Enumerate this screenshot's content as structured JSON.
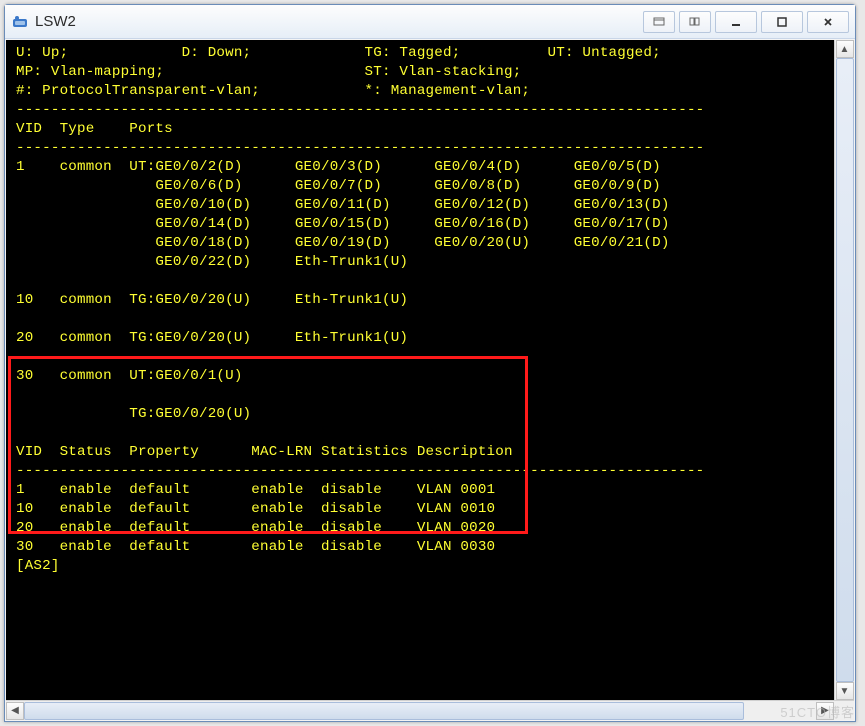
{
  "window": {
    "title": "LSW2"
  },
  "legend": {
    "line1": "U: Up;             D: Down;             TG: Tagged;          UT: Untagged;",
    "line2": "MP: Vlan-mapping;                       ST: Vlan-stacking;",
    "line3": "#: ProtocolTransparent-vlan;            *: Management-vlan;"
  },
  "dash": "-------------------------------------------------------------------------------",
  "hdr1": "VID  Type    Ports",
  "ports": {
    "l1": "1    common  UT:GE0/0/2(D)      GE0/0/3(D)      GE0/0/4(D)      GE0/0/5(D)",
    "l2": "                GE0/0/6(D)      GE0/0/7(D)      GE0/0/8(D)      GE0/0/9(D)",
    "l3": "                GE0/0/10(D)     GE0/0/11(D)     GE0/0/12(D)     GE0/0/13(D)",
    "l4": "                GE0/0/14(D)     GE0/0/15(D)     GE0/0/16(D)     GE0/0/17(D)",
    "l5": "                GE0/0/18(D)     GE0/0/19(D)     GE0/0/20(U)     GE0/0/21(D)",
    "l6": "                GE0/0/22(D)     Eth-Trunk1(U)",
    "l7": "",
    "l8": "10   common  TG:GE0/0/20(U)     Eth-Trunk1(U)",
    "l9": "",
    "l10": "20   common  TG:GE0/0/20(U)     Eth-Trunk1(U)",
    "l11": "",
    "l12": "30   common  UT:GE0/0/1(U)",
    "l13": "",
    "l14": "             TG:GE0/0/20(U)",
    "l15": ""
  },
  "hdr2": "VID  Status  Property      MAC-LRN Statistics Description",
  "stats": {
    "s1": "1    enable  default       enable  disable    VLAN 0001",
    "s2": "10   enable  default       enable  disable    VLAN 0010",
    "s3": "20   enable  default       enable  disable    VLAN 0020",
    "s4": "30   enable  default       enable  disable    VLAN 0030"
  },
  "prompt": "[AS2]",
  "watermark": "51CTO博客"
}
